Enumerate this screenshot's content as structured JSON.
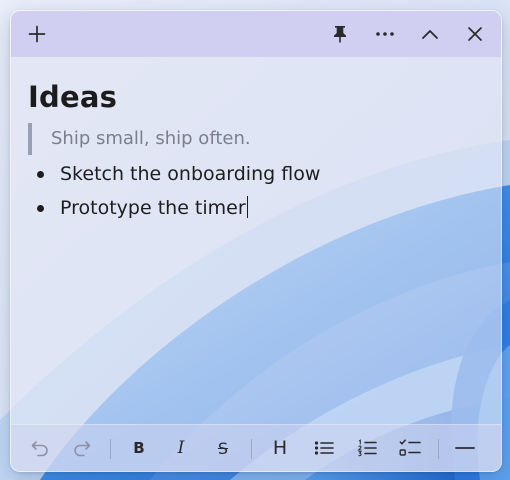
{
  "window": {
    "accent": "#cecdf0",
    "titlebar": {
      "new_note_icon": "plus-icon",
      "pin_icon": "pin-icon",
      "more_icon": "ellipsis-icon",
      "collapse_icon": "chevron-up-icon",
      "close_icon": "close-icon"
    }
  },
  "note": {
    "heading": "Ideas",
    "quote": "Ship small, ship often.",
    "bullets": [
      "Sketch the onboarding flow",
      "Prototype the timer"
    ]
  },
  "toolbar": {
    "undo_icon": "undo-icon",
    "redo_icon": "redo-icon",
    "bold_label": "B",
    "italic_label": "I",
    "strikethrough_label": "S",
    "heading_label": "H",
    "bullet_list_icon": "bullet-list-icon",
    "numbered_list_icon": "numbered-list-icon",
    "checklist_icon": "checklist-icon",
    "divider_icon": "horizontal-rule-icon"
  }
}
